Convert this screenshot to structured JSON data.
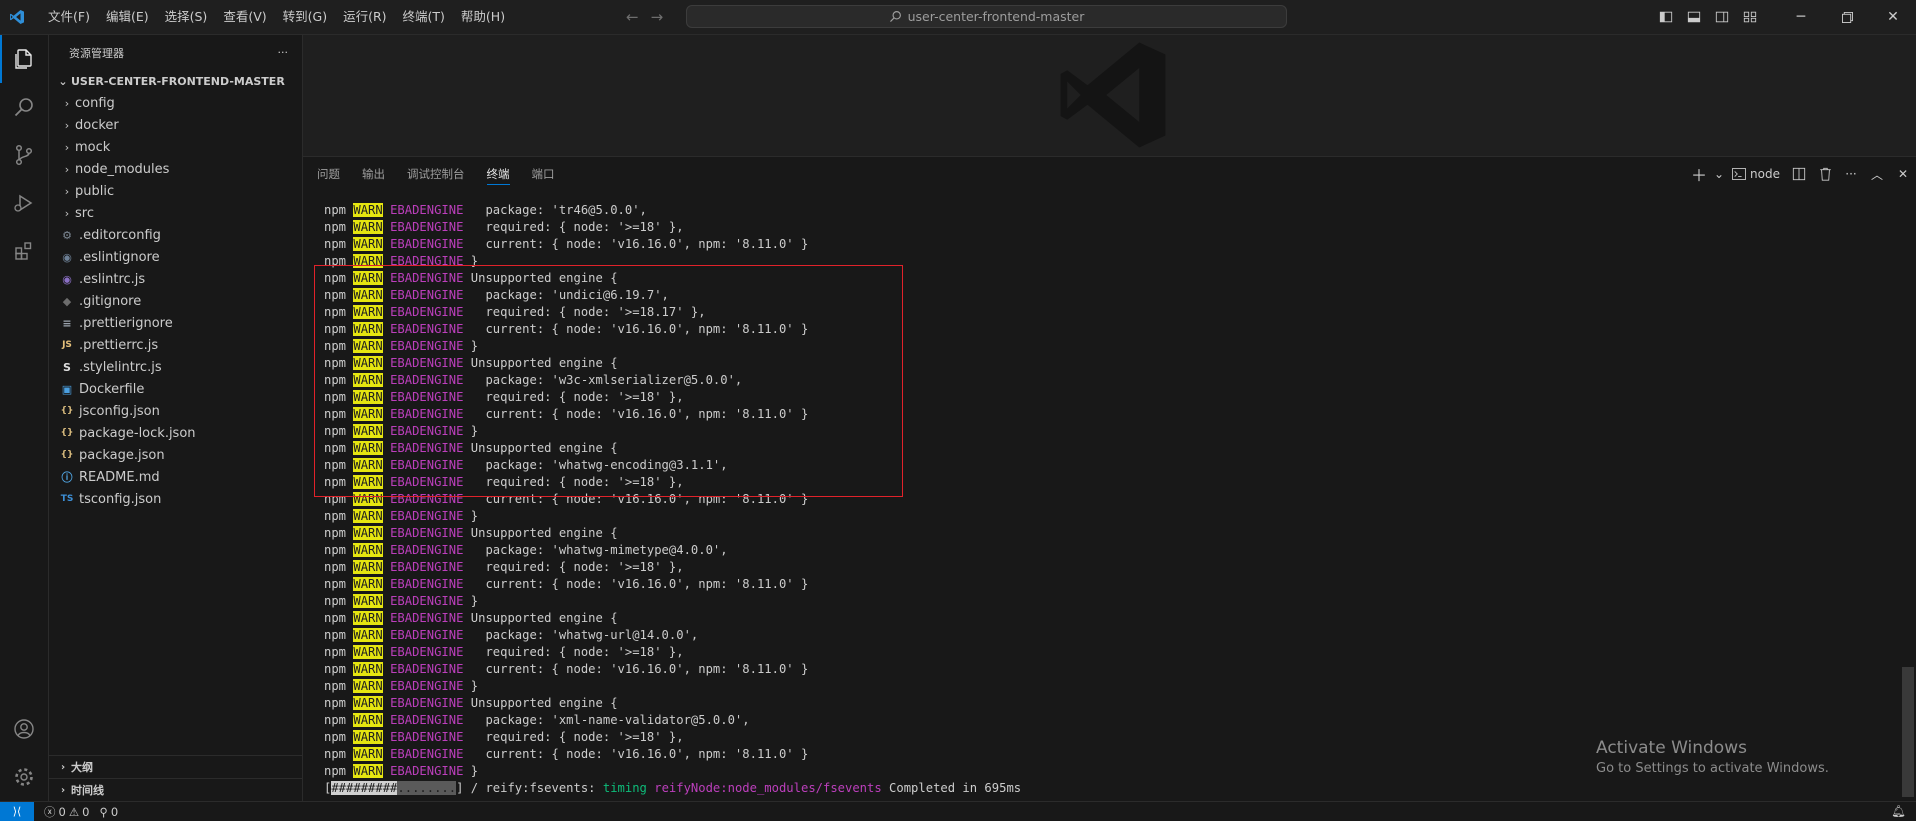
{
  "titlebar": {
    "menu": [
      "文件(F)",
      "编辑(E)",
      "选择(S)",
      "查看(V)",
      "转到(G)",
      "运行(R)",
      "终端(T)",
      "帮助(H)"
    ],
    "search_text": "user-center-frontend-master"
  },
  "sidebar": {
    "header": "资源管理器",
    "more": "···",
    "project": "USER-CENTER-FRONTEND-MASTER",
    "folders": [
      {
        "name": "config"
      },
      {
        "name": "docker"
      },
      {
        "name": "mock"
      },
      {
        "name": "node_modules"
      },
      {
        "name": "public"
      },
      {
        "name": "src"
      }
    ],
    "files": [
      {
        "name": ".editorconfig",
        "icon": "gear-icon",
        "glyph": "⚙",
        "color": "#7f8a96"
      },
      {
        "name": ".eslintignore",
        "icon": "circle-icon",
        "glyph": "◉",
        "color": "#6d8096"
      },
      {
        "name": ".eslintrc.js",
        "icon": "eslint-icon",
        "glyph": "◉",
        "color": "#8a6fc4"
      },
      {
        "name": ".gitignore",
        "icon": "git-icon",
        "glyph": "◆",
        "color": "#6d6d6d"
      },
      {
        "name": ".prettierignore",
        "icon": "lines-icon",
        "glyph": "≡",
        "color": "#9aa3ad"
      },
      {
        "name": ".prettierrc.js",
        "icon": "js-icon",
        "glyph": "JS",
        "color": "#e5c07b"
      },
      {
        "name": ".stylelintrc.js",
        "icon": "stylelint-icon",
        "glyph": "S",
        "color": "#dddddd"
      },
      {
        "name": "Dockerfile",
        "icon": "docker-icon",
        "glyph": "▣",
        "color": "#4a9fe0"
      },
      {
        "name": "jsconfig.json",
        "icon": "braces-icon",
        "glyph": "{}",
        "color": "#d7ba7d"
      },
      {
        "name": "package-lock.json",
        "icon": "braces-icon",
        "glyph": "{}",
        "color": "#d7ba7d"
      },
      {
        "name": "package.json",
        "icon": "braces-icon",
        "glyph": "{}",
        "color": "#d7ba7d"
      },
      {
        "name": "README.md",
        "icon": "info-icon",
        "glyph": "ⓘ",
        "color": "#4fa3e0"
      },
      {
        "name": "tsconfig.json",
        "icon": "ts-icon",
        "glyph": "TS",
        "color": "#3d8fd6"
      }
    ],
    "outline": "大纲",
    "timeline": "时间线"
  },
  "panel": {
    "tabs": [
      "问题",
      "输出",
      "调试控制台",
      "终端",
      "端口"
    ],
    "active_tab": "终端",
    "terminal_name": "node"
  },
  "terminal": {
    "lines": [
      {
        "warn": true,
        "text": "  package: 'tr46@5.0.0',"
      },
      {
        "warn": true,
        "text": "  required: { node: '>=18' },"
      },
      {
        "warn": true,
        "text": "  current: { node: 'v16.16.0', npm: '8.11.0' }"
      },
      {
        "warn": true,
        "text": "}"
      },
      {
        "warn": true,
        "text": "Unsupported engine {"
      },
      {
        "warn": true,
        "text": "  package: 'undici@6.19.7',"
      },
      {
        "warn": true,
        "text": "  required: { node: '>=18.17' },"
      },
      {
        "warn": true,
        "text": "  current: { node: 'v16.16.0', npm: '8.11.0' }"
      },
      {
        "warn": true,
        "text": "}"
      },
      {
        "warn": true,
        "text": "Unsupported engine {"
      },
      {
        "warn": true,
        "text": "  package: 'w3c-xmlserializer@5.0.0',"
      },
      {
        "warn": true,
        "text": "  required: { node: '>=18' },"
      },
      {
        "warn": true,
        "text": "  current: { node: 'v16.16.0', npm: '8.11.0' }"
      },
      {
        "warn": true,
        "text": "}"
      },
      {
        "warn": true,
        "text": "Unsupported engine {"
      },
      {
        "warn": true,
        "text": "  package: 'whatwg-encoding@3.1.1',"
      },
      {
        "warn": true,
        "text": "  required: { node: '>=18' },"
      },
      {
        "warn": true,
        "text": "  current: { node: 'v16.16.0', npm: '8.11.0' }"
      },
      {
        "warn": true,
        "text": "}"
      },
      {
        "warn": true,
        "text": "Unsupported engine {"
      },
      {
        "warn": true,
        "text": "  package: 'whatwg-mimetype@4.0.0',"
      },
      {
        "warn": true,
        "text": "  required: { node: '>=18' },"
      },
      {
        "warn": true,
        "text": "  current: { node: 'v16.16.0', npm: '8.11.0' }"
      },
      {
        "warn": true,
        "text": "}"
      },
      {
        "warn": true,
        "text": "Unsupported engine {"
      },
      {
        "warn": true,
        "text": "  package: 'whatwg-url@14.0.0',"
      },
      {
        "warn": true,
        "text": "  required: { node: '>=18' },"
      },
      {
        "warn": true,
        "text": "  current: { node: 'v16.16.0', npm: '8.11.0' }"
      },
      {
        "warn": true,
        "text": "}"
      },
      {
        "warn": true,
        "text": "Unsupported engine {"
      },
      {
        "warn": true,
        "text": "  package: 'xml-name-validator@5.0.0',"
      },
      {
        "warn": true,
        "text": "  required: { node: '>=18' },"
      },
      {
        "warn": true,
        "text": "  current: { node: 'v16.16.0', npm: '8.11.0' }"
      },
      {
        "warn": true,
        "text": "}"
      }
    ],
    "npm_label": "npm",
    "warn_label": "WARN",
    "code_label": "EBADENGINE",
    "progress": {
      "open": "[",
      "filled": "#########",
      "empty": "........",
      "close": "]",
      "rest": " / reify:fsevents: ",
      "timing": "timing",
      "reify_node": " reifyNode:node_modules/fsevents",
      "done": " Completed in 695ms"
    }
  },
  "watermark": {
    "title": "Activate Windows",
    "subtitle": "Go to Settings to activate Windows."
  },
  "statusbar": {
    "errors": "0",
    "warnings": "0",
    "ports": "0"
  },
  "colors": {
    "accent": "#0078d4",
    "warn_bg": "#e5e510",
    "code": "#bc3fbc",
    "timing": "#0dbc79",
    "highlight_box": "#e0222a"
  }
}
